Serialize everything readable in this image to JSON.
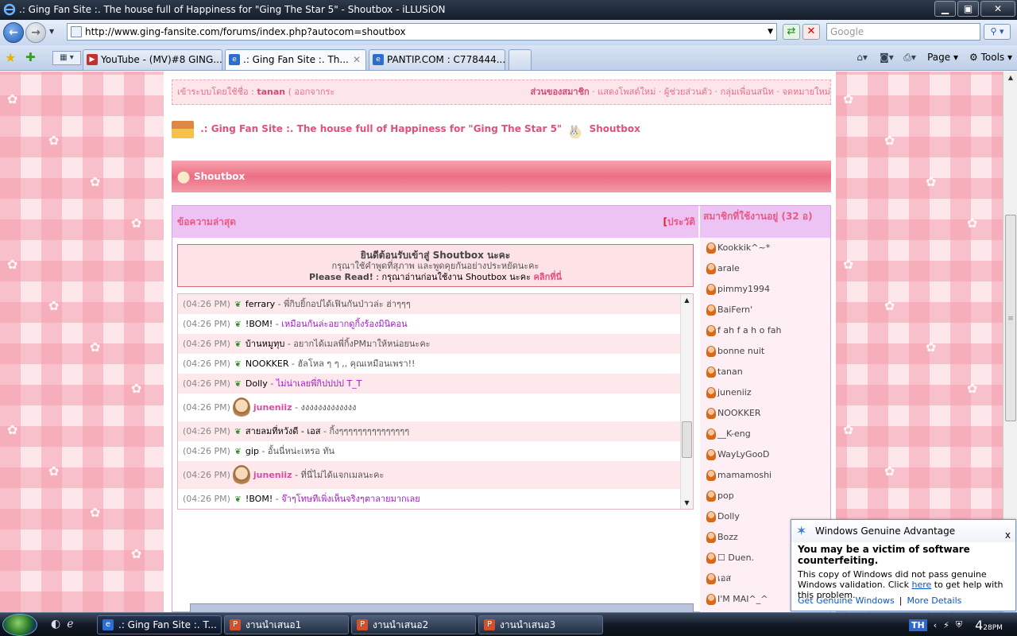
{
  "window": {
    "title": ".: Ging Fan Site :. The house full of Happiness for \"Ging The Star 5\" - Shoutbox - iLLUSiON",
    "min_icon": "minimize-icon",
    "max_icon": "maximize-icon",
    "close_icon": "close-icon"
  },
  "nav": {
    "url": "http://www.ging-fansite.com/forums/index.php?autocom=shoutbox",
    "search_placeholder": "Google"
  },
  "tabs": [
    {
      "label": "YouTube - (MV)#8 GING...",
      "icon": "youtube-icon"
    },
    {
      "label": ".: Ging Fan Site :. Th...",
      "icon": "ie-icon",
      "active": true
    },
    {
      "label": "PANTIP.COM : C778444...",
      "icon": "ie-icon"
    }
  ],
  "toolbar": {
    "page_label": "Page",
    "tools_label": "Tools"
  },
  "userbar": {
    "prefix": "เข้าระบบโดยใช้ชื่อ :",
    "username": "tanan",
    "logout": "( ออกจากระ",
    "member_area": "ส่วนของสมาชิก",
    "links": "· แสดงโพสต์ใหม่ · ผู้ช่วยส่วนตัว · กลุ่มเพื่อนสนิท · จดหมายใหม่"
  },
  "breadcrumb": {
    "site": ".: Ging Fan Site :. The house full of Happiness for \"Ging The Star 5\"",
    "page": "Shoutbox"
  },
  "shoutbox": {
    "header": "Shoutbox",
    "latest_label": "ข้อความล่าสุด",
    "history_label": "ประวัติ",
    "welcome_title": "ยินดีต้อนรับเข้าสู่ Shoutbox นะคะ",
    "welcome_sub": "กรุณาใช้คำพูดที่สุภาพ และพูดคุยกันอย่างประหยัดนะคะ",
    "read_prefix": "Please Read!",
    "read_text": ": กรุณาอ่านก่อนใช้งาน Shoutbox นะคะ",
    "read_link": "คลิกที่นี่",
    "messages": [
      {
        "time": "(04:26 PM)",
        "name": "ferrary",
        "text": "- พี่กิบยิ้กอปได้เฟินกันป่าวล่ะ ฮ่าๆๆๆ",
        "style": "normal",
        "avatar": false
      },
      {
        "time": "(04:26 PM)",
        "name": "!BOM!",
        "text": "- เหมือนกันล่ะอยากดูกิ้งร้องมินิคอน",
        "style": "purple",
        "avatar": false
      },
      {
        "time": "(04:26 PM)",
        "name": "บ้านหมูทุบ",
        "text": "- อยากได้เมลพี่กิ้งPMมาให้หน่อยนะคะ",
        "style": "normal",
        "avatar": false
      },
      {
        "time": "(04:26 PM)",
        "name": "NOOKKER",
        "text": "- ฮัลโหล ๆ ๆ ,, คุณเหมือนเพรา!!",
        "style": "normal",
        "avatar": false
      },
      {
        "time": "(04:26 PM)",
        "name": "Dolly",
        "text": "- ไม่น่าเลยพี่กิปปปป T_T",
        "style": "purple",
        "avatar": false
      },
      {
        "time": "(04:26 PM)",
        "name": "juneniiz",
        "text": "- งงงงงงงงงงงงง",
        "style": "normal",
        "avatar": true
      },
      {
        "time": "(04:26 PM)",
        "name": "สายลมที่หวังดี - เอส",
        "text": "- กิ้งๆๆๆๆๆๆๆๆๆๆๆๆๆๆๆ",
        "style": "normal",
        "avatar": false
      },
      {
        "time": "(04:26 PM)",
        "name": "gip",
        "text": "- อั้นนี่หน่ะเหรอ ทัน",
        "style": "normal",
        "avatar": false
      },
      {
        "time": "(04:26 PM)",
        "name": "juneniiz",
        "text": "- ที่นี่ไม่ได้แจกเมลนะคะ",
        "style": "normal",
        "avatar": true
      },
      {
        "time": "(04:26 PM)",
        "name": "!BOM!",
        "text": "- จ๊าๆโทษทีเพิ่งเห็นจริงๆตาลายมากเลย",
        "style": "purple",
        "avatar": false
      }
    ]
  },
  "members": {
    "header": "สมาชิกที่ใช้งานอยู่ (32 อ)",
    "list": [
      "Kookkik^~*",
      "arale",
      "pimmy1994",
      "BaiFern'",
      "f ah f a h o fah",
      "bonne nuit",
      "tanan",
      "juneniiz",
      "NOOKKER",
      "__K-eng",
      "WayLyGooD",
      "mamamoshi",
      "pop",
      "Dolly",
      "Bozz",
      "☐ Duen.",
      "เอส",
      "I'M MAI^_^"
    ]
  },
  "wga": {
    "title": "Windows Genuine Advantage",
    "headline": "You may be a victim of software counterfeiting.",
    "body_pre": "This copy of Windows did not pass genuine Windows validation. Click",
    "body_link": "here",
    "body_post": "to get help with this problem.",
    "link1": "Get Genuine Windows",
    "sep": "|",
    "link2": "More Details",
    "close": "x"
  },
  "taskbar": {
    "items": [
      {
        "label": ".: Ging Fan Site :. T...",
        "icon": "ie-icon",
        "active": true
      },
      {
        "label": "งานนำเสนอ1",
        "icon": "powerpoint-icon"
      },
      {
        "label": "งานนำเสนอ2",
        "icon": "powerpoint-icon"
      },
      {
        "label": "งานนำเสนอ3",
        "icon": "powerpoint-icon"
      }
    ],
    "lang": "TH",
    "time": "4",
    "time_min": "28",
    "time_pm": "PM"
  },
  "colors": {
    "accent_pink": "#e0507c",
    "header_pink": "#ec6f84",
    "lavender": "#ecc3f2",
    "purple_text": "#a418c9"
  }
}
